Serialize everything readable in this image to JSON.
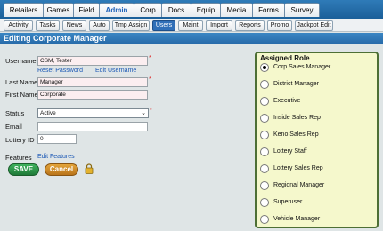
{
  "top_tabs": [
    {
      "label": "Retailers",
      "active": false
    },
    {
      "label": "Games",
      "active": false
    },
    {
      "label": "Field",
      "active": false
    },
    {
      "label": "Admin",
      "active": true
    },
    {
      "label": "Corp",
      "active": false
    },
    {
      "label": "Docs",
      "active": false
    },
    {
      "label": "Equip",
      "active": false
    },
    {
      "label": "Media",
      "active": false
    },
    {
      "label": "Forms",
      "active": false
    },
    {
      "label": "Survey",
      "active": false
    }
  ],
  "sub_tabs": [
    {
      "label": "Activity",
      "active": false
    },
    {
      "label": "Tasks",
      "active": false
    },
    {
      "label": "News",
      "active": false
    },
    {
      "label": "Auto",
      "active": false
    },
    {
      "label": "Tmp Assign",
      "active": false
    },
    {
      "label": "Users",
      "active": true
    },
    {
      "label": "Maint",
      "active": false
    },
    {
      "label": "Import",
      "active": false
    },
    {
      "label": "Reports",
      "active": false
    },
    {
      "label": "Promo",
      "active": false
    },
    {
      "label": "Jackpot Edit",
      "active": false
    }
  ],
  "heading": "Editing Corporate Manager",
  "form": {
    "username_label": "Username",
    "username_value": "CSM, Tester",
    "reset_password_link": "Reset Password",
    "edit_username_link": "Edit Username",
    "last_name_label": "Last Name",
    "last_name_value": "Manager",
    "first_name_label": "First Name",
    "first_name_value": "Corporate",
    "status_label": "Status",
    "status_value": "Active",
    "email_label": "Email",
    "email_value": "",
    "lottery_id_label": "Lottery ID",
    "lottery_id_value": "0",
    "features_label": "Features",
    "edit_features_link": "Edit Features",
    "required_mark": "*",
    "save_label": "SAVE",
    "cancel_label": "Cancel",
    "dropdown_glyph": "⌄"
  },
  "roles": {
    "title": "Assigned Role",
    "items": [
      {
        "label": "Corp Sales Manager",
        "selected": true
      },
      {
        "label": "District Manager",
        "selected": false
      },
      {
        "label": "Executive",
        "selected": false
      },
      {
        "label": "Inside Sales Rep",
        "selected": false
      },
      {
        "label": "Keno Sales Rep",
        "selected": false
      },
      {
        "label": "Lottery Staff",
        "selected": false
      },
      {
        "label": "Lottery Sales Rep",
        "selected": false
      },
      {
        "label": "Regional Manager",
        "selected": false
      },
      {
        "label": "Superuser",
        "selected": false
      },
      {
        "label": "Vehicle Manager",
        "selected": false
      }
    ]
  },
  "icons": {
    "lock": "lock-icon"
  },
  "colors": {
    "accent_blue": "#2669a8",
    "save_green": "#1f7a38",
    "cancel_orange": "#b9741a",
    "role_panel_bg": "#f5f8cc",
    "required_red": "#dd2222"
  }
}
